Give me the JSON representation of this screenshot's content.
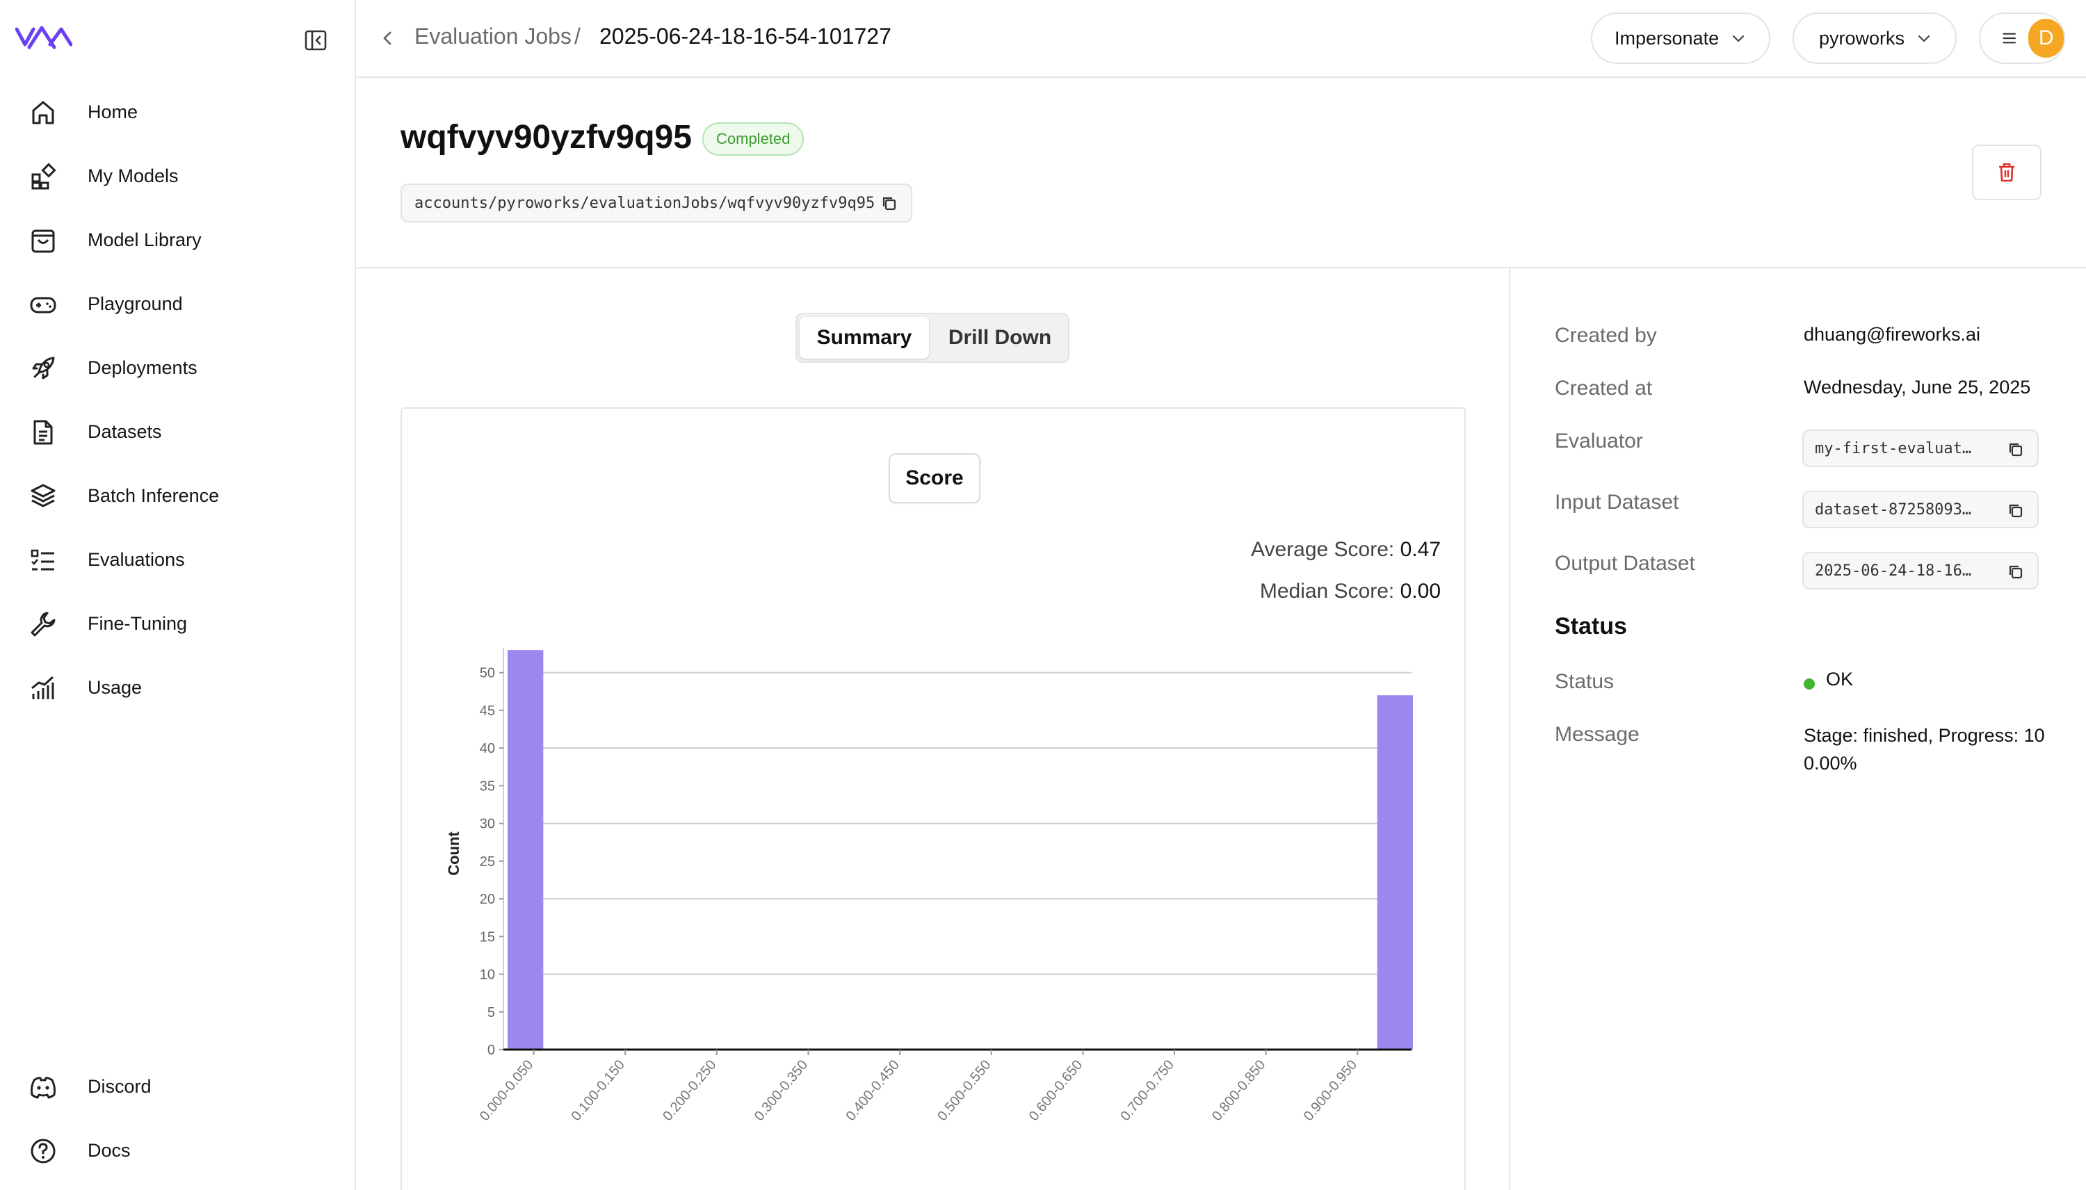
{
  "sidebar": {
    "items": [
      {
        "label": "Home",
        "icon": "home-icon"
      },
      {
        "label": "My Models",
        "icon": "models-icon"
      },
      {
        "label": "Model Library",
        "icon": "library-icon"
      },
      {
        "label": "Playground",
        "icon": "gamepad-icon"
      },
      {
        "label": "Deployments",
        "icon": "rocket-icon"
      },
      {
        "label": "Datasets",
        "icon": "document-icon"
      },
      {
        "label": "Batch Inference",
        "icon": "layers-icon"
      },
      {
        "label": "Evaluations",
        "icon": "checklist-icon"
      },
      {
        "label": "Fine-Tuning",
        "icon": "wrench-icon"
      },
      {
        "label": "Usage",
        "icon": "chart-icon"
      }
    ],
    "footer": [
      {
        "label": "Discord",
        "icon": "discord-icon"
      },
      {
        "label": "Docs",
        "icon": "help-icon"
      }
    ]
  },
  "topbar": {
    "breadcrumb_parent": "Evaluation Jobs",
    "breadcrumb_separator": "/",
    "breadcrumb_current": "2025-06-24-18-16-54-101727",
    "impersonate_label": "Impersonate",
    "account_label": "pyroworks",
    "avatar_initial": "D"
  },
  "header": {
    "title": "wqfvyv90yzfv9q95",
    "status_badge": "Completed",
    "resource_path": "accounts/pyroworks/evaluationJobs/wqfvyv90yzfv9q95"
  },
  "main": {
    "tabs": [
      "Summary",
      "Drill Down"
    ],
    "active_tab": "Summary",
    "metric_tab": "Score",
    "average_label": "Average Score:",
    "average_value": "0.47",
    "median_label": "Median Score:",
    "median_value": "0.00"
  },
  "details": {
    "created_by_label": "Created by",
    "created_by": "dhuang@fireworks.ai",
    "created_at_label": "Created at",
    "created_at": "Wednesday, June 25, 2025",
    "evaluator_label": "Evaluator",
    "evaluator": "my-first-evaluat…",
    "input_dataset_label": "Input Dataset",
    "input_dataset": "dataset-87258093…",
    "output_dataset_label": "Output Dataset",
    "output_dataset": "2025-06-24-18-16…",
    "status_heading": "Status",
    "status_label": "Status",
    "status_value": "OK",
    "message_label": "Message",
    "message": "Stage: finished, Progress: 100.00%"
  },
  "colors": {
    "brand": "#6b3ff2",
    "bar": "#9b87ee",
    "status_ok": "#3fb62e",
    "badge_text": "#3b9b2f",
    "delete": "#e0302a",
    "avatar": "#f5a623"
  },
  "chart_data": {
    "type": "bar",
    "ylabel": "Count",
    "xlabel": "",
    "ylim": [
      0,
      52
    ],
    "yticks": [
      0,
      5,
      10,
      15,
      20,
      25,
      30,
      35,
      40,
      45,
      50
    ],
    "grid": true,
    "tick_labels": [
      "0.000-0.050",
      "0.100-0.150",
      "0.200-0.250",
      "0.300-0.350",
      "0.400-0.450",
      "0.500-0.550",
      "0.600-0.650",
      "0.700-0.750",
      "0.800-0.850",
      "0.900-0.950"
    ],
    "categories": [
      "0.000-0.050",
      "0.050-0.100",
      "0.100-0.150",
      "0.150-0.200",
      "0.200-0.250",
      "0.250-0.300",
      "0.300-0.350",
      "0.350-0.400",
      "0.400-0.450",
      "0.450-0.500",
      "0.500-0.550",
      "0.550-0.600",
      "0.600-0.650",
      "0.650-0.700",
      "0.700-0.750",
      "0.750-0.800",
      "0.800-0.850",
      "0.850-0.900",
      "0.900-0.950",
      "0.950-1.000"
    ],
    "values": [
      53,
      0,
      0,
      0,
      0,
      0,
      0,
      0,
      0,
      0,
      0,
      0,
      0,
      0,
      0,
      0,
      0,
      0,
      0,
      47
    ]
  }
}
